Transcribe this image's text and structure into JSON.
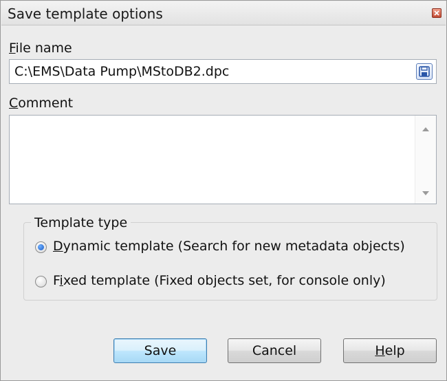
{
  "window": {
    "title": "Save template options"
  },
  "file": {
    "label": "File name",
    "label_accel": "F",
    "label_rest": "ile name",
    "value": "C:\\EMS\\Data Pump\\MStoDB2.dpc"
  },
  "comment": {
    "label_accel": "C",
    "label_rest": "omment",
    "value": ""
  },
  "template_type": {
    "legend": "Template type",
    "options": [
      {
        "accel": "D",
        "rest": "ynamic template (Search for new metadata objects)",
        "checked": true
      },
      {
        "pre": "F",
        "accel": "i",
        "rest": "xed template (Fixed objects set, for console only)",
        "checked": false
      }
    ]
  },
  "buttons": {
    "save": "Save",
    "cancel": "Cancel",
    "help_accel": "H",
    "help_rest": "elp"
  },
  "colors": {
    "dialog_bg": "#ececec",
    "close_button": "#c24a33",
    "default_button_border": "#3c7fb1"
  }
}
